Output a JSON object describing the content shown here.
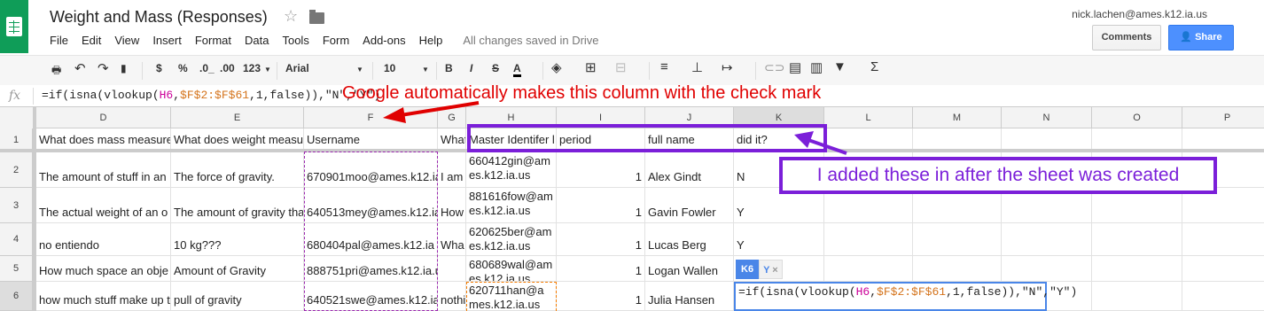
{
  "app": {
    "title": "Weight and Mass (Responses)",
    "user_email": "nick.lachen@ames.k12.ia.us",
    "comments_label": "Comments",
    "share_label": "Share",
    "saved_status": "All changes saved in Drive"
  },
  "menu": [
    "File",
    "Edit",
    "View",
    "Insert",
    "Format",
    "Data",
    "Tools",
    "Form",
    "Add-ons",
    "Help"
  ],
  "toolbar": {
    "currency": "$",
    "percent": "%",
    "dec_decrease": ".0_",
    "dec_increase": ".00",
    "number_format": "123",
    "font": "Arial",
    "font_size": "10",
    "bold": "B",
    "italic": "I",
    "strike": "S",
    "text_color": "A",
    "sum": "Σ"
  },
  "formula_bar": {
    "fx": "fx",
    "parts": [
      "=if(isna(vlookup(",
      "H6",
      ",",
      "$F$2:$F$61",
      ",1,false)),\"N\",\"Y\")"
    ]
  },
  "columns": [
    "D",
    "E",
    "F",
    "G",
    "H",
    "I",
    "J",
    "K",
    "L",
    "M",
    "N",
    "O",
    "P"
  ],
  "rows": [
    {
      "num": "1",
      "D": "What does mass measure",
      "E": "What does weight measure",
      "F": "Username",
      "G": "What",
      "H": "Master Identifer l",
      "I": "period",
      "J": "full name",
      "K": "did it?"
    },
    {
      "num": "2",
      "D": "The amount of stuff in an",
      "E": "The force of gravity.",
      "F": "670901moo@ames.k12.ia",
      "G": "I am",
      "H": "660412gin@ames.k12.ia.us",
      "I": "1",
      "J": "Alex Gindt",
      "K": "N"
    },
    {
      "num": "3",
      "D": "The actual weight of an o",
      "E": "The amount of gravity tha",
      "F": "640513mey@ames.k12.ia",
      "G": "How",
      "H": "881616fow@ames.k12.ia.us",
      "I": "1",
      "J": "Gavin  Fowler",
      "K": "Y"
    },
    {
      "num": "4",
      "D": "no entiendo",
      "E": "10 kg???",
      "F": "680404pal@ames.k12.ia",
      "G": "Wha",
      "H": "620625ber@ames.k12.ia.us",
      "I": "1",
      "J": "Lucas Berg",
      "K": "Y"
    },
    {
      "num": "5",
      "D": "How much space an obje",
      "E": "Amount of Gravity",
      "F": "888751pri@ames.k12.ia.us",
      "G": "",
      "H": "680689wal@ames.k12.ia.us",
      "I": "1",
      "J": "Logan Wallen",
      "K": ""
    },
    {
      "num": "6",
      "D": "how much stuff make up t",
      "E": "pull of gravity",
      "F": "640521swe@ames.k12.ia.",
      "G": "nothi",
      "H": "620711han@ames.k12.ia.us",
      "I": "1",
      "J": "Julia Hansen",
      "K": ""
    }
  ],
  "active_cell": {
    "ref": "K6",
    "preview": "Y",
    "close": "×",
    "parts": [
      "=if(isna(vlookup(",
      "H6",
      ",",
      "$F$2:$F$61",
      ",1,false)),\"N\",\"Y\")"
    ]
  },
  "annotations": {
    "red_note": "Google automatically makes this column with the check mark",
    "purple_note": "I added these in after the sheet was created",
    "red_color": "#e00000",
    "purple_color": "#7b1fd9"
  }
}
